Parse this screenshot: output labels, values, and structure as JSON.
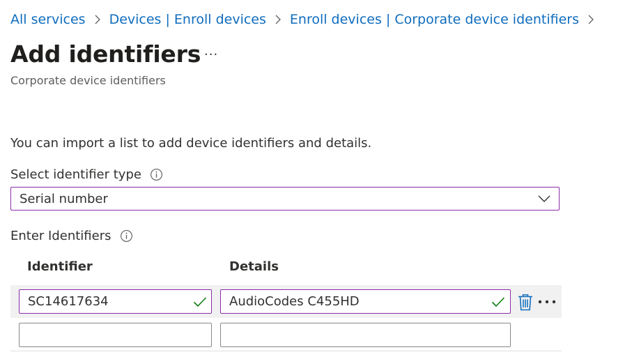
{
  "breadcrumb": {
    "items": [
      "All services",
      "Devices | Enroll devices",
      "Enroll devices | Corporate device identifiers"
    ]
  },
  "header": {
    "title": "Add identifiers",
    "more": "···",
    "subtitle": "Corporate device identifiers"
  },
  "intro": "You can import a list to add device identifiers and details.",
  "identifier_type": {
    "label": "Select identifier type",
    "selected": "Serial number"
  },
  "identifiers": {
    "label": "Enter Identifiers",
    "columns": [
      "Identifier",
      "Details"
    ],
    "rows": [
      {
        "identifier": "SC14617634",
        "details": "AudioCodes C455HD"
      },
      {
        "identifier": "",
        "details": ""
      }
    ]
  },
  "colors": {
    "link": "#0f6cbd",
    "focus_border": "#8a2da8",
    "valid_check": "#107c10",
    "trash": "#0f6cbd"
  }
}
